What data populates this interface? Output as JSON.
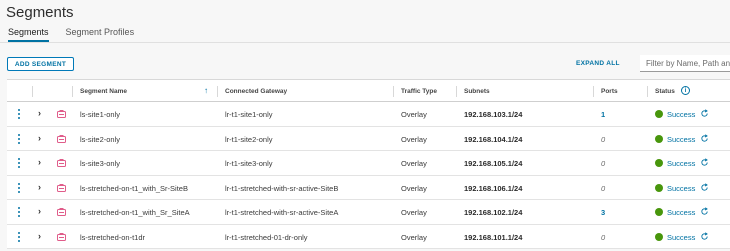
{
  "page": {
    "title": "Segments"
  },
  "tabs": [
    {
      "label": "Segments",
      "active": true
    },
    {
      "label": "Segment Profiles",
      "active": false
    }
  ],
  "toolbar": {
    "add_label": "ADD SEGMENT",
    "expand_label": "EXPAND ALL",
    "filter_placeholder": "Filter by Name, Path and more"
  },
  "table": {
    "columns": [
      "Segment Name",
      "Connected Gateway",
      "Traffic Type",
      "Subnets",
      "Ports",
      "Status"
    ],
    "rows": [
      {
        "name": "ls-site1-only",
        "gateway": "lr-t1-site1-only",
        "traffic": "Overlay",
        "subnet": "192.168.103.1/24",
        "ports": "1",
        "status": "Success"
      },
      {
        "name": "ls-site2-only",
        "gateway": "lr-t1-site2-only",
        "traffic": "Overlay",
        "subnet": "192.168.104.1/24",
        "ports": "0",
        "status": "Success"
      },
      {
        "name": "ls-site3-only",
        "gateway": "lr-t1-site3-only",
        "traffic": "Overlay",
        "subnet": "192.168.105.1/24",
        "ports": "0",
        "status": "Success"
      },
      {
        "name": "ls-stretched-on-t1_with_Sr-SiteB",
        "gateway": "lr-t1-stretched-with-sr-active-SiteB",
        "traffic": "Overlay",
        "subnet": "192.168.106.1/24",
        "ports": "0",
        "status": "Success"
      },
      {
        "name": "ls-stretched-on-t1_with_Sr_SiteA",
        "gateway": "lr-t1-stretched-with-sr-active-SiteA",
        "traffic": "Overlay",
        "subnet": "192.168.102.1/24",
        "ports": "3",
        "status": "Success"
      },
      {
        "name": "ls-stretched-on-t1dr",
        "gateway": "lr-t1-stretched-01-dr-only",
        "traffic": "Overlay",
        "subnet": "192.168.101.1/24",
        "ports": "0",
        "status": "Success"
      }
    ]
  },
  "colors": {
    "accent": "#0072a3",
    "success": "#48960c",
    "segment_icon": "#e05c8a"
  },
  "icons": [
    "kebab-menu-icon",
    "chevron-right-icon",
    "segment-icon",
    "sort-up-icon",
    "info-icon",
    "refresh-icon"
  ]
}
